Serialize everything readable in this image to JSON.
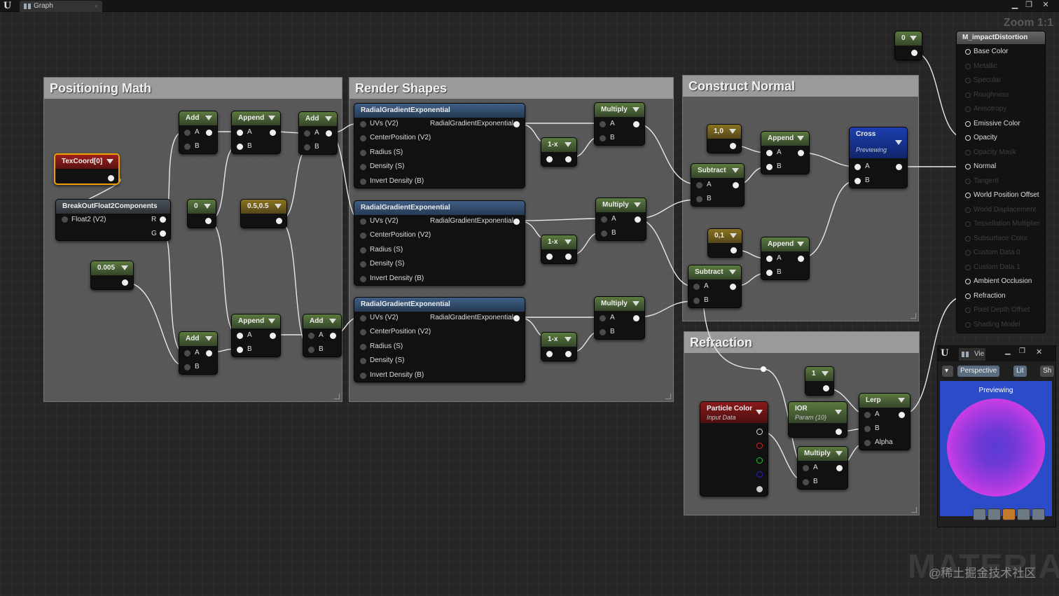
{
  "window": {
    "tab_title": "Graph",
    "tab_close": "×",
    "zoom": "Zoom 1:1",
    "min": "▁",
    "max": "❐",
    "close": "✕"
  },
  "comments": {
    "positioning": "Positioning Math",
    "render": "Render Shapes",
    "normal": "Construct Normal",
    "refraction": "Refraction"
  },
  "nodes": {
    "add": "Add",
    "append": "Append",
    "multiply": "Multiply",
    "subtract": "Subtract",
    "one_minus_x": "1-x",
    "lerp": "Lerp",
    "cross": "Cross",
    "previewing": "Previewing",
    "texcoord": "TexCoord[0]",
    "breakout": "BreakOutFloat2Components",
    "float2": "Float2 (V2)",
    "const_zero": "0",
    "const_half": "0.5,0.5",
    "const_005": "0.005",
    "const_10": "1,0",
    "const_01": "0,1",
    "const_one": "1",
    "const_top": "0",
    "radial": "RadialGradientExponential",
    "radial_pins": [
      "UVs (V2)",
      "CenterPosition (V2)",
      "Radius (S)",
      "Density (S)",
      "Invert Density (B)"
    ],
    "particle": "Particle Color",
    "input_data": "Input Data",
    "ior": "IOR",
    "param": "Param (10)",
    "pin_a": "A",
    "pin_b": "B",
    "pin_r": "R",
    "pin_g": "G",
    "pin_alpha": "Alpha"
  },
  "material": {
    "title": "M_impactDistortion",
    "inputs": [
      "Base Color",
      "Metallic",
      "Specular",
      "Roughness",
      "Anisotropy",
      "Emissive Color",
      "Opacity",
      "Opacity Mask",
      "Normal",
      "Tangent",
      "World Position Offset",
      "World Displacement",
      "Tessellation Multiplier",
      "Subsurface Color",
      "Custom Data 0",
      "Custom Data 1",
      "Ambient Occlusion",
      "Refraction",
      "Pixel Depth Offset",
      "Shading Model"
    ]
  },
  "preview": {
    "tab": "Vie",
    "perspective": "Perspective",
    "lit": "Lit",
    "sh": "Sh",
    "label": "Previewing"
  },
  "watermark": "MATERIAL",
  "credit": "@稀土掘金技术社区"
}
